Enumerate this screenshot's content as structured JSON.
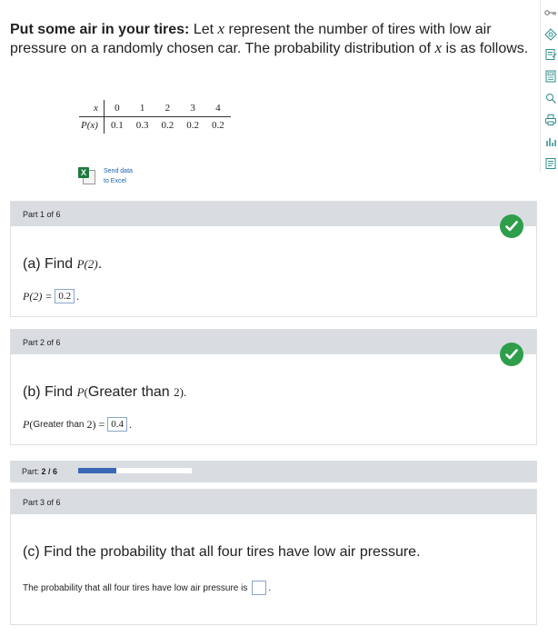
{
  "problem": {
    "title": "Put some air in your tires:",
    "text_before_var": "Let",
    "var": "x",
    "text_mid": "represent the number of tires with low air pressure on a randomly chosen car. The probability distribution of",
    "var2": "x",
    "text_after": "is as follows."
  },
  "table": {
    "header_label": "x",
    "row_label": "P(x)",
    "x_values": [
      "0",
      "1",
      "2",
      "3",
      "4"
    ],
    "p_values": [
      "0.1",
      "0.3",
      "0.2",
      "0.2",
      "0.2"
    ]
  },
  "excel": {
    "line1": "Send data",
    "line2": "to Excel"
  },
  "part1": {
    "header": "Part 1 of 6",
    "question_prefix": "(a) Find",
    "question_math": "P(2)",
    "question_suffix": ".",
    "answer_lhs": "P(2) =",
    "answer_value": "0.2",
    "status": "correct"
  },
  "part2": {
    "header": "Part 2 of 6",
    "question_prefix": "(b) Find",
    "question_math_p": "P",
    "question_math_paren": "(",
    "question_text": "Greater than",
    "question_math_end": "2).",
    "answer_lhs_p": "P",
    "answer_lhs_paren": "(",
    "answer_lhs_text": "Greater than",
    "answer_lhs_end": "2) =",
    "answer_value": "0.4",
    "status": "correct"
  },
  "progress": {
    "label": "Part:",
    "value_text": "2 / 6",
    "fraction": 0.333
  },
  "part3": {
    "header": "Part 3 of 6",
    "question": "(c) Find the probability that all four tires have low air pressure.",
    "answer_prompt": "The probability that all four tires have low air pressure is",
    "answer_value": "",
    "answer_suffix": "."
  },
  "tools": [
    "key-icon",
    "compass-icon",
    "edit-icon",
    "calculator-icon",
    "search-book-icon",
    "printer-icon",
    "chart-icon",
    "save-icon"
  ],
  "colors": {
    "header_bg": "#d9dde2",
    "check_green": "#2e9e4b",
    "progress_fill": "#3a68b5",
    "input_border": "#8aa4c8",
    "link_blue": "#1a5fb4"
  }
}
